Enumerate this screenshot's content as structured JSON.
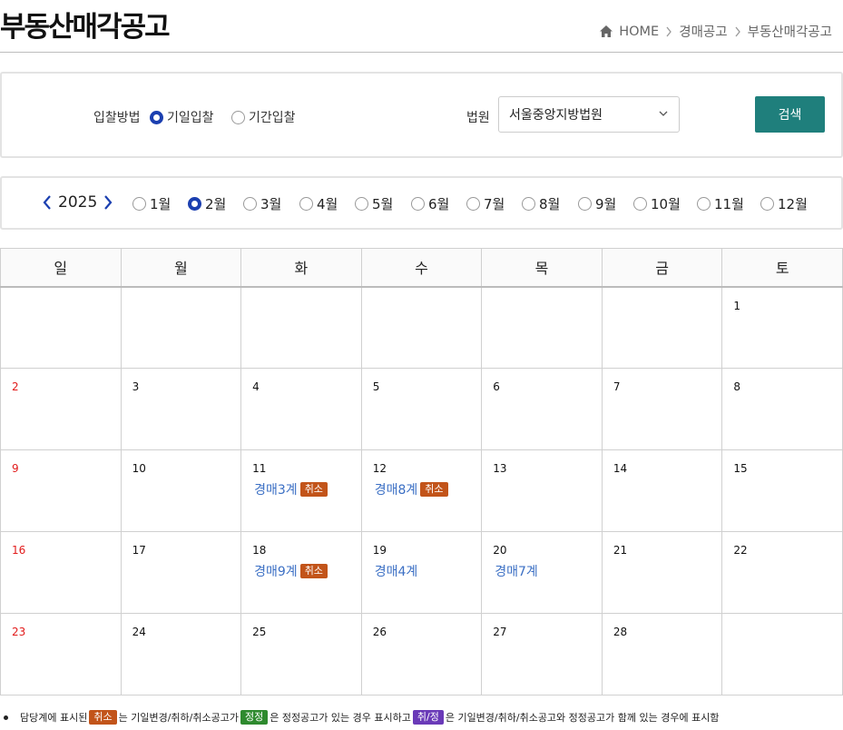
{
  "header": {
    "title": "부동산매각공고",
    "breadcrumb": [
      "HOME",
      "경매공고",
      "부동산매각공고"
    ]
  },
  "search": {
    "bid_method_label": "입찰방법",
    "bid_options": [
      {
        "label": "기일입찰",
        "checked": true
      },
      {
        "label": "기간입찰",
        "checked": false
      }
    ],
    "court_label": "법원",
    "court_value": "서울중앙지방법원",
    "search_button": "검색"
  },
  "month_nav": {
    "year": "2025",
    "months": [
      {
        "label": "1월",
        "checked": false
      },
      {
        "label": "2월",
        "checked": true
      },
      {
        "label": "3월",
        "checked": false
      },
      {
        "label": "4월",
        "checked": false
      },
      {
        "label": "5월",
        "checked": false
      },
      {
        "label": "6월",
        "checked": false
      },
      {
        "label": "7월",
        "checked": false
      },
      {
        "label": "8월",
        "checked": false
      },
      {
        "label": "9월",
        "checked": false
      },
      {
        "label": "10월",
        "checked": false
      },
      {
        "label": "11월",
        "checked": false
      },
      {
        "label": "12월",
        "checked": false
      }
    ]
  },
  "calendar": {
    "weekdays": [
      "일",
      "월",
      "화",
      "수",
      "목",
      "금",
      "토"
    ],
    "weeks": [
      [
        null,
        null,
        null,
        null,
        null,
        null,
        {
          "day": "1",
          "events": []
        }
      ],
      [
        {
          "day": "2",
          "events": []
        },
        {
          "day": "3",
          "events": []
        },
        {
          "day": "4",
          "events": []
        },
        {
          "day": "5",
          "events": []
        },
        {
          "day": "6",
          "events": []
        },
        {
          "day": "7",
          "events": []
        },
        {
          "day": "8",
          "events": []
        }
      ],
      [
        {
          "day": "9",
          "events": []
        },
        {
          "day": "10",
          "events": []
        },
        {
          "day": "11",
          "events": [
            {
              "label": "경매3계",
              "badge": "취소"
            }
          ]
        },
        {
          "day": "12",
          "events": [
            {
              "label": "경매8계",
              "badge": "취소"
            }
          ]
        },
        {
          "day": "13",
          "events": []
        },
        {
          "day": "14",
          "events": []
        },
        {
          "day": "15",
          "events": []
        }
      ],
      [
        {
          "day": "16",
          "events": []
        },
        {
          "day": "17",
          "events": []
        },
        {
          "day": "18",
          "events": [
            {
              "label": "경매9계",
              "badge": "취소"
            }
          ]
        },
        {
          "day": "19",
          "events": [
            {
              "label": "경매4계",
              "badge": null
            }
          ]
        },
        {
          "day": "20",
          "events": [
            {
              "label": "경매7계",
              "badge": null
            }
          ]
        },
        {
          "day": "21",
          "events": []
        },
        {
          "day": "22",
          "events": []
        }
      ],
      [
        {
          "day": "23",
          "events": []
        },
        {
          "day": "24",
          "events": []
        },
        {
          "day": "25",
          "events": []
        },
        {
          "day": "26",
          "events": []
        },
        {
          "day": "27",
          "events": []
        },
        {
          "day": "28",
          "events": []
        },
        null
      ]
    ]
  },
  "legend": {
    "t1": "담당계에 표시된",
    "b1": "취소",
    "t2": "는 기일변경/취하/취소공고가",
    "b2": "정정",
    "t3": "은 정정공고가 있는 경우 표시하고",
    "b3": "취/정",
    "t4": "은 기일변경/취하/취소공고와 정정공고가 함께 있는 경우에 표시함"
  },
  "colors": {
    "accent": "#1f7f7c",
    "radio": "#1b3fb0",
    "sunday": "#e21b1b",
    "event_link": "#3b6fc4",
    "badge_cancel": "#c2541a",
    "badge_correct": "#2e8a2e",
    "badge_both": "#6a3ab8"
  }
}
